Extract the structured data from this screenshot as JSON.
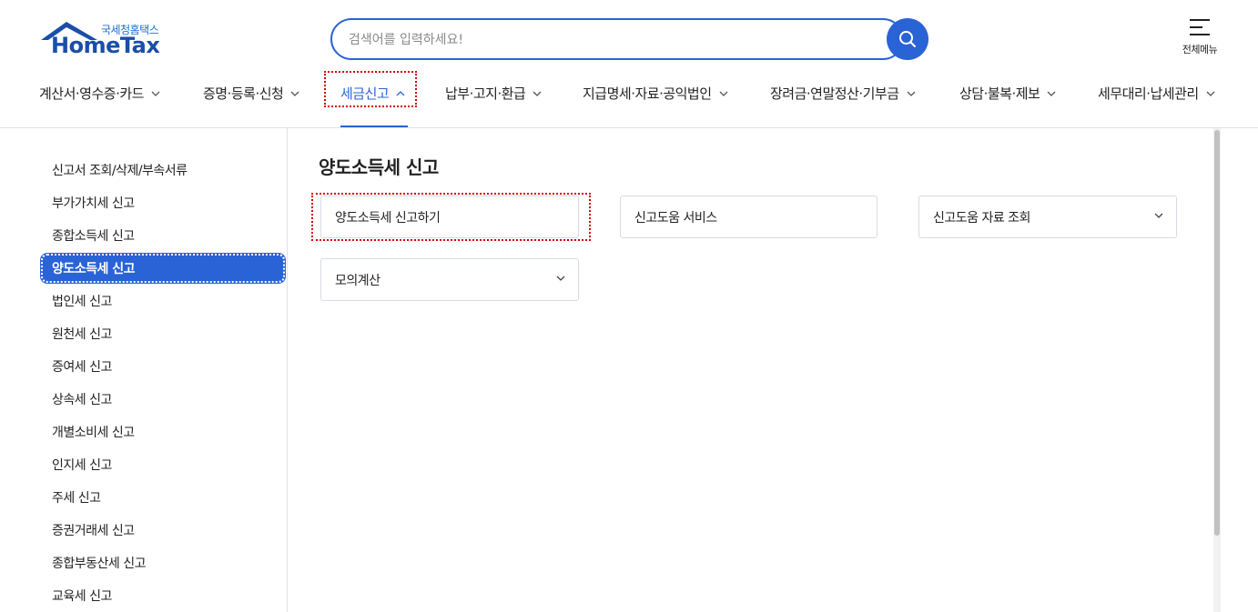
{
  "logo": {
    "subtitle": "국세청홈택스",
    "name": "HomeTax"
  },
  "search": {
    "placeholder": "검색어를 입력하세요!",
    "icon": "search-icon"
  },
  "all_menu": {
    "label": "전체메뉴",
    "icon": "hamburger-icon"
  },
  "gnb": {
    "items": [
      {
        "label": "계산서·영수증·카드",
        "expanded": false
      },
      {
        "label": "증명·등록·신청",
        "expanded": false
      },
      {
        "label": "세금신고",
        "expanded": true
      },
      {
        "label": "납부·고지·환급",
        "expanded": false
      },
      {
        "label": "지급명세·자료·공익법인",
        "expanded": false
      },
      {
        "label": "장려금·연말정산·기부금",
        "expanded": false
      },
      {
        "label": "상담·불복·제보",
        "expanded": false
      },
      {
        "label": "세무대리·납세관리",
        "expanded": false
      }
    ]
  },
  "sidebar": {
    "items": [
      {
        "label": "신고서 조회/삭제/부속서류"
      },
      {
        "label": "부가가치세 신고"
      },
      {
        "label": "종합소득세 신고"
      },
      {
        "label": "양도소득세 신고",
        "active": true
      },
      {
        "label": "법인세 신고"
      },
      {
        "label": "원천세 신고"
      },
      {
        "label": "증여세 신고"
      },
      {
        "label": "상속세 신고"
      },
      {
        "label": "개별소비세 신고"
      },
      {
        "label": "인지세 신고"
      },
      {
        "label": "주세 신고"
      },
      {
        "label": "증권거래세 신고"
      },
      {
        "label": "종합부동산세 신고"
      },
      {
        "label": "교육세 신고"
      }
    ]
  },
  "main": {
    "title": "양도소득세 신고",
    "cards": [
      {
        "label": "양도소득세 신고하기",
        "has_dropdown": false
      },
      {
        "label": "신고도움 서비스",
        "has_dropdown": false
      },
      {
        "label": "신고도움 자료 조회",
        "has_dropdown": true
      },
      {
        "label": "모의계산",
        "has_dropdown": true
      }
    ]
  },
  "colors": {
    "accent": "#2a63d6",
    "focus_outline": "#d40000",
    "border": "#d6dbe4"
  }
}
